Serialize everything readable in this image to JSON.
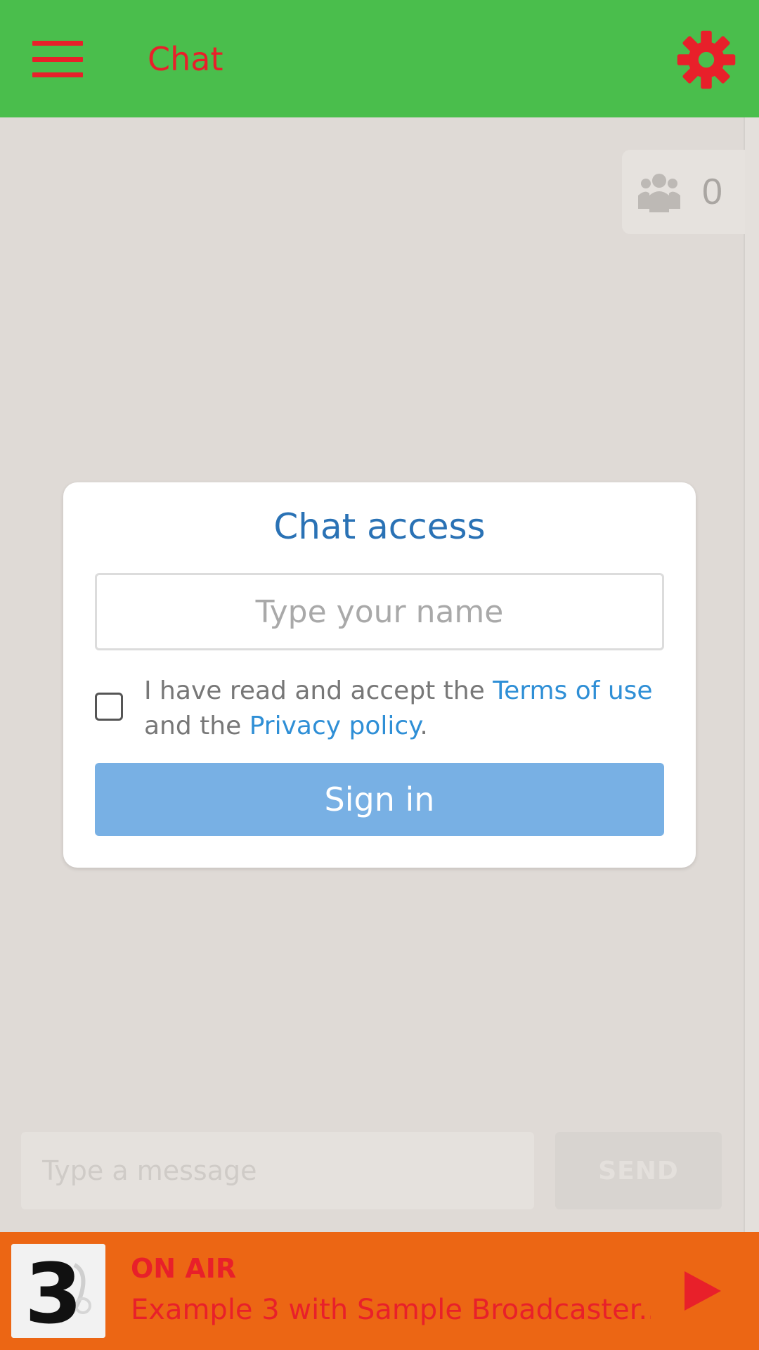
{
  "header": {
    "title": "Chat",
    "menu_icon": "hamburger-menu-icon",
    "settings_icon": "gear-icon",
    "bg_color": "#4abe4c",
    "accent_color": "#e8202a"
  },
  "users": {
    "icon": "users-group-icon",
    "count": "0"
  },
  "modal": {
    "title": "Chat access",
    "name_placeholder": "Type your name",
    "terms_prefix": "I have read and accept the ",
    "terms_link": "Terms of use",
    "terms_middle": " and the ",
    "privacy_link": "Privacy policy",
    "terms_suffix": ".",
    "signin_label": "Sign in",
    "checkbox_checked": false
  },
  "composer": {
    "message_placeholder": "Type a message",
    "send_label": "SEND"
  },
  "player": {
    "status": "ON AIR",
    "now_playing": "Example 3 with Sample Broadcaster..",
    "cover_label": "3",
    "play_icon": "play-icon",
    "bg_color": "#ec6614"
  }
}
